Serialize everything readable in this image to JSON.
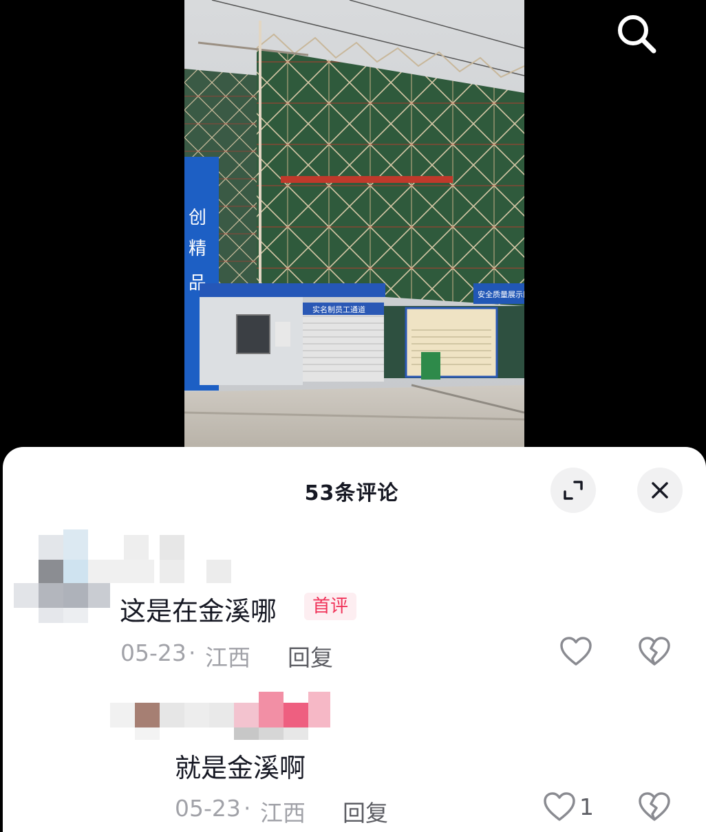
{
  "video": {
    "building_banner": "实名制员工通道",
    "side_sign": "创 精 品",
    "display_board": "安全质量展示区"
  },
  "icons": {
    "search": "search-icon",
    "expand": "expand-icon",
    "close": "close-icon",
    "like": "heart-icon",
    "dislike": "broken-heart-icon"
  },
  "comments_panel": {
    "title": "53条评论"
  },
  "comments": [
    {
      "text": "这是在金溪哪",
      "badge": "首评",
      "date": "05-23",
      "separator": "·",
      "region": "江西",
      "reply_label": "回复",
      "like_count": ""
    },
    {
      "text": "就是金溪啊",
      "date": "05-23",
      "separator": "·",
      "region": "江西",
      "reply_label": "回复",
      "like_count": "1"
    }
  ],
  "colors": {
    "badge_text": "#f0345a",
    "badge_bg": "#fdeef1",
    "meta_text": "#a1a2a8",
    "title_text": "#161823"
  }
}
